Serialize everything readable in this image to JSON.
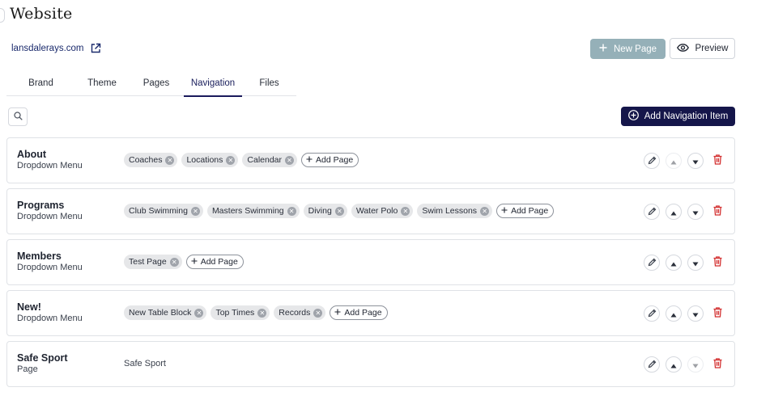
{
  "header": {
    "title": "Website",
    "site_link": "lansdalerays.com",
    "new_page_label": "New Page",
    "preview_label": "Preview"
  },
  "tabs": [
    {
      "label": "Brand"
    },
    {
      "label": "Theme"
    },
    {
      "label": "Pages"
    },
    {
      "label": "Navigation",
      "active": true
    },
    {
      "label": "Files"
    }
  ],
  "toolbar": {
    "add_nav_label": "Add Navigation Item"
  },
  "add_page_label": "Add Page",
  "nav_items": [
    {
      "title": "About",
      "type": "Dropdown Menu",
      "pages": [
        "Coaches",
        "Locations",
        "Calendar"
      ],
      "up_enabled": false,
      "down_enabled": true
    },
    {
      "title": "Programs",
      "type": "Dropdown Menu",
      "pages": [
        "Club Swimming",
        "Masters Swimming",
        "Diving",
        "Water Polo",
        "Swim Lessons"
      ],
      "up_enabled": true,
      "down_enabled": true
    },
    {
      "title": "Members",
      "type": "Dropdown Menu",
      "pages": [
        "Test Page"
      ],
      "up_enabled": true,
      "down_enabled": true
    },
    {
      "title": "New!",
      "type": "Dropdown Menu",
      "pages": [
        "New Table Block",
        "Top Times",
        "Records"
      ],
      "up_enabled": true,
      "down_enabled": true
    },
    {
      "title": "Safe Sport",
      "type": "Page",
      "value": "Safe Sport",
      "up_enabled": true,
      "down_enabled": false
    }
  ],
  "colors": {
    "primary": "#15164a",
    "new_page_button": "#95b0b8",
    "delete": "#d32f2f"
  }
}
